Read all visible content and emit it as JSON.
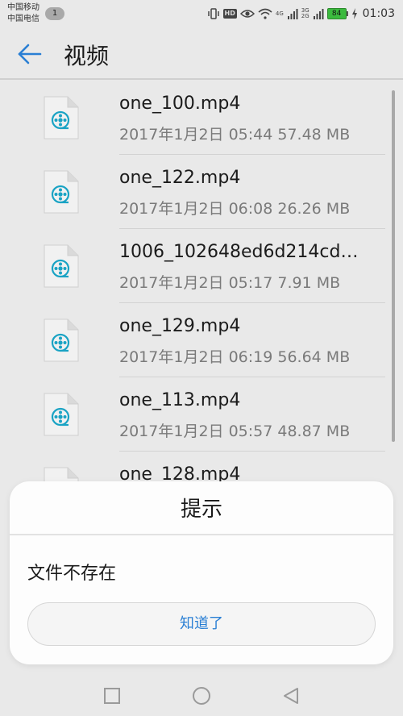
{
  "status_bar": {
    "carrier_1": "中国移动",
    "carrier_2": "中国电信",
    "sim_badge": "1",
    "hd_label": "HD",
    "net_4g": "4G",
    "net_3g": "3G",
    "net_2g": "2G",
    "battery_level": "84",
    "time": "01:03",
    "icons": [
      "vibrate-icon",
      "hd-icon",
      "eye-icon",
      "wifi-icon",
      "signal-icon",
      "battery-icon",
      "charging-icon"
    ]
  },
  "app_bar": {
    "title": "视频",
    "back_icon": "back-arrow-icon"
  },
  "files": [
    {
      "name": "one_100.mp4",
      "meta": "2017年1月2日 05:44 57.48 MB"
    },
    {
      "name": "one_122.mp4",
      "meta": "2017年1月2日 06:08 26.26 MB"
    },
    {
      "name": "1006_102648ed6d214cd…",
      "meta": "2017年1月2日 05:17 7.91 MB"
    },
    {
      "name": "one_129.mp4",
      "meta": "2017年1月2日 06:19 56.64 MB"
    },
    {
      "name": "one_113.mp4",
      "meta": "2017年1月2日 05:57 48.87 MB"
    },
    {
      "name": "one_128.mp4",
      "meta": ""
    }
  ],
  "dialog": {
    "title": "提示",
    "message": "文件不存在",
    "ok_label": "知道了"
  },
  "colors": {
    "accent": "#2a7fd4",
    "file_icon_teal": "#1aa3c4",
    "battery_green": "#3bba3e"
  },
  "nav_bar": {
    "icons": [
      "recent-apps-icon",
      "home-icon",
      "back-triangle-icon"
    ]
  }
}
